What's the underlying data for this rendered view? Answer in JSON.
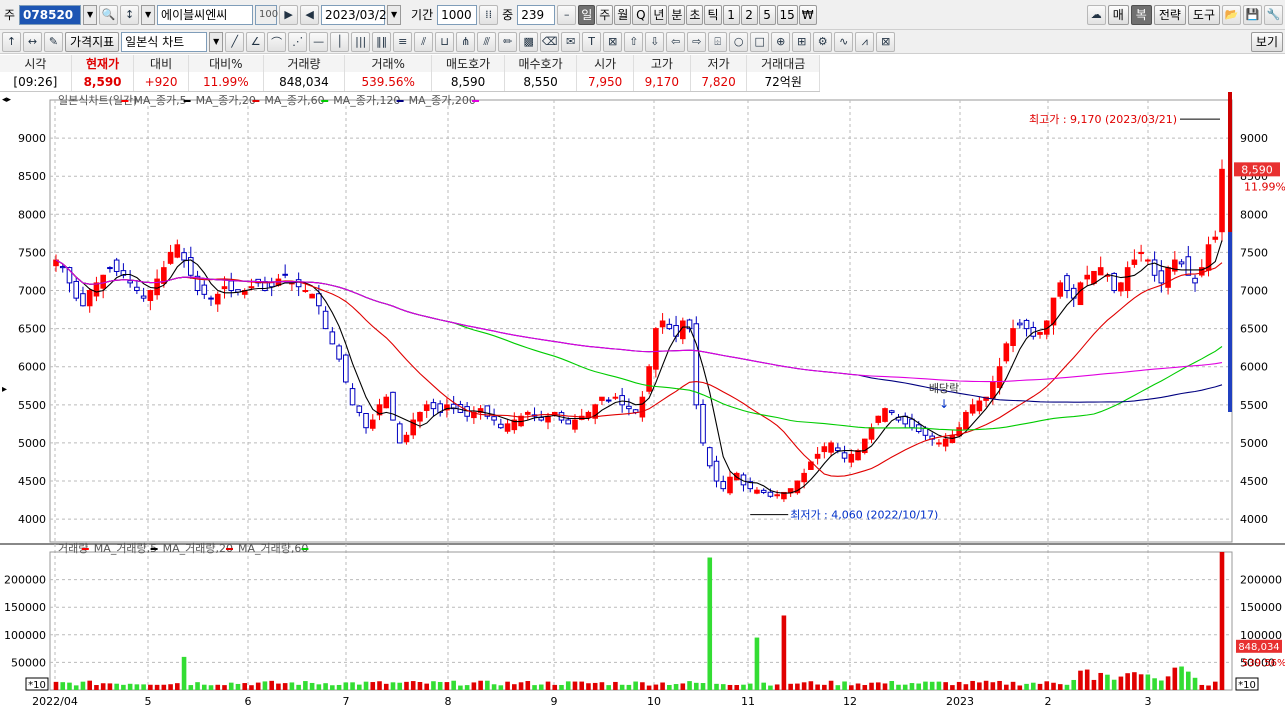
{
  "toolbar1": {
    "market_label": "주",
    "code_value": "078520",
    "name_value": "에이블씨엔씨",
    "pct_value": "100",
    "date_value": "2023/03/21",
    "period_label": "기간",
    "period_value": "1000",
    "count_label": "중",
    "count_value": "239",
    "period_tabs": [
      "일",
      "주",
      "월",
      "Q",
      "년",
      "분",
      "초",
      "틱",
      "1",
      "2",
      "5",
      "15",
      "₩"
    ],
    "selected_tab": "일",
    "right_buttons": [
      "매",
      "복",
      "전략",
      "도구"
    ]
  },
  "toolbar2": {
    "indicator_label": "가격지표",
    "chart_type_value": "일본식 차트",
    "view_label": "보기"
  },
  "quote": {
    "headers": [
      "시각",
      "현재가",
      "대비",
      "대비%",
      "거래량",
      "거래%",
      "매도호가",
      "매수호가",
      "시가",
      "고가",
      "저가",
      "거래대금"
    ],
    "time": "[09:26]",
    "price": "8,590",
    "change": "+920",
    "change_pct": "11.99%",
    "volume": "848,034",
    "volume_pct": "539.56%",
    "ask": "8,590",
    "bid": "8,550",
    "open": "7,950",
    "high": "9,170",
    "low": "7,820",
    "amount": "72억원"
  },
  "price_panel": {
    "legend": [
      {
        "label": "일본식차트(일간)",
        "color": "#ff0000"
      },
      {
        "label": "MA_종가,5",
        "color": "#000000"
      },
      {
        "label": "MA_종가,20",
        "color": "#e00000"
      },
      {
        "label": "MA_종가,60",
        "color": "#00cc00"
      },
      {
        "label": "MA_종가,120",
        "color": "#000080"
      },
      {
        "label": "MA_종가,200",
        "color": "#e000e0"
      }
    ],
    "high_annotation": "최고가 : 9,170 (2023/03/21)",
    "low_annotation": "최저가 : 4,060 (2022/10/17)",
    "event_label": "배당락",
    "last_price_tag": "8,590",
    "last_change_tag": "11.99%"
  },
  "volume_panel": {
    "legend": [
      {
        "label": "거래량",
        "color": "#ff0000"
      },
      {
        "label": "MA_거래량,5",
        "color": "#000000"
      },
      {
        "label": "MA_거래량,20",
        "color": "#e00000"
      },
      {
        "label": "MA_거래량,60",
        "color": "#00cc00"
      }
    ],
    "scale_tag": "*10",
    "last_volume_tag": "848,034",
    "last_pct_tag": "539.56%"
  },
  "colors": {
    "up": "#ff0000",
    "down": "#0000c0",
    "ma5": "#000000",
    "ma20": "#e00000",
    "ma60": "#00cc00",
    "ma120": "#000080",
    "ma200": "#e000e0"
  },
  "chart_data": {
    "type": "candlestick",
    "y_axis_price": {
      "ticks": [
        4000,
        4500,
        5000,
        5500,
        6000,
        6500,
        7000,
        7500,
        8000,
        8500,
        9000
      ],
      "range": [
        3700,
        9500
      ]
    },
    "y_axis_volume": {
      "ticks": [
        50000,
        100000,
        150000,
        200000
      ],
      "range": [
        0,
        250000
      ]
    },
    "x_axis_labels": [
      "2022/04",
      "5",
      "6",
      "7",
      "8",
      "9",
      "10",
      "11",
      "12",
      "2023",
      "2",
      "3"
    ],
    "close_series": [
      7400,
      7300,
      7100,
      6900,
      6800,
      7000,
      7100,
      7200,
      7300,
      7250,
      7200,
      7100,
      7000,
      6900,
      7000,
      7150,
      7300,
      7500,
      7600,
      7400,
      7200,
      7000,
      6950,
      6900,
      6950,
      7050,
      7000,
      6980,
      7000,
      7050,
      7100,
      7000,
      7050,
      7150,
      7200,
      7100,
      7050,
      7000,
      6950,
      6800,
      6500,
      6300,
      6100,
      5800,
      5500,
      5400,
      5200,
      5300,
      5500,
      5600,
      5300,
      5000,
      5100,
      5300,
      5400,
      5500,
      5450,
      5400,
      5500,
      5450,
      5400,
      5350,
      5400,
      5450,
      5350,
      5300,
      5200,
      5250,
      5300,
      5350,
      5400,
      5350,
      5300,
      5350,
      5400,
      5300,
      5250,
      5300,
      5350,
      5400,
      5500,
      5600,
      5550,
      5600,
      5500,
      5450,
      5400,
      5600,
      6000,
      6500,
      6600,
      6500,
      6400,
      6600,
      6500,
      5500,
      5000,
      4700,
      4500,
      4400,
      4550,
      4600,
      4450,
      4400,
      4380,
      4350,
      4300,
      4320,
      4350,
      4400,
      4500,
      4600,
      4750,
      4850,
      4950,
      5000,
      4900,
      4800,
      4850,
      4900,
      5050,
      5200,
      5350,
      5450,
      5400,
      5300,
      5250,
      5200,
      5150,
      5100,
      5050,
      5000,
      5050,
      5100,
      5200,
      5400,
      5500,
      5550,
      5600,
      5800,
      6000,
      6300,
      6500,
      6550,
      6500,
      6400,
      6450,
      6600,
      6900,
      7100,
      7000,
      6900,
      7100,
      7200,
      7250,
      7300,
      7200,
      7000,
      7100,
      7300,
      7400,
      7500,
      7400,
      7200,
      7100,
      7300,
      7400,
      7350,
      7200,
      7100,
      7300,
      7600,
      7700,
      8590
    ],
    "high": 9170,
    "low": 4060,
    "volume_peaks": [
      {
        "x": "5",
        "value": 60000
      },
      {
        "x": "9",
        "value": 240000
      },
      {
        "x": "10",
        "value": 135000
      },
      {
        "x": "2023/03/21",
        "value": 848034
      }
    ]
  }
}
